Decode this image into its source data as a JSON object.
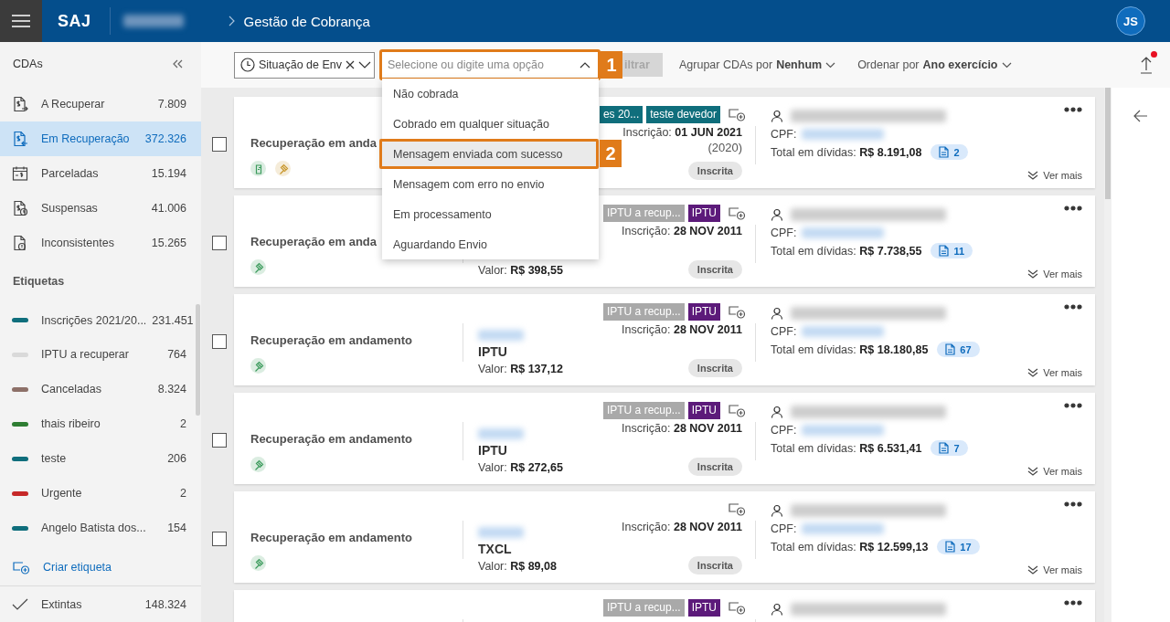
{
  "header": {
    "brand": "SAJ",
    "redacted_org": true,
    "breadcrumb": "Gestão de Cobrança",
    "avatar": "JS"
  },
  "sidebar": {
    "title": "CDAs",
    "items": [
      {
        "kind": "doc-out",
        "label": "A Recuperar",
        "count": "7.809",
        "selected": false
      },
      {
        "kind": "doc-in",
        "label": "Em Recuperação",
        "count": "372.326",
        "selected": true
      },
      {
        "kind": "calendar",
        "label": "Parceladas",
        "count": "15.194",
        "selected": false
      },
      {
        "kind": "doc-pause",
        "label": "Suspensas",
        "count": "41.006",
        "selected": false
      },
      {
        "kind": "doc-alert",
        "label": "Inconsistentes",
        "count": "15.265",
        "selected": false
      }
    ],
    "tags_title": "Etiquetas",
    "tags": [
      {
        "label": "Inscrições 2021/20...",
        "count": "231.451",
        "color": "#0f6e7c"
      },
      {
        "label": "IPTU a recuperar",
        "count": "764",
        "color": "#d9d9d9"
      },
      {
        "label": "Canceladas",
        "count": "8.324",
        "color": "#8d7068"
      },
      {
        "label": "thais ribeiro",
        "count": "2",
        "color": "#2e7d32"
      },
      {
        "label": "teste",
        "count": "206",
        "color": "#0f6e7c"
      },
      {
        "label": "Urgente",
        "count": "2",
        "color": "#c62828"
      },
      {
        "label": "Angelo Batista dos...",
        "count": "154",
        "color": "#0f6e7c"
      }
    ],
    "create_label": "Criar etiqueta",
    "footer": {
      "label": "Extintas",
      "count": "148.324"
    }
  },
  "toolbar": {
    "filter_chip": "Situação de Env",
    "combo": {
      "placeholder": "Selecione ou digite uma opção",
      "expanded": true,
      "callout": "1"
    },
    "filter_button": {
      "label": "iltrar",
      "disabled": true
    },
    "group_by": {
      "label": "Agrupar CDAs por",
      "value": "Nenhum"
    },
    "sort_by": {
      "label": "Ordenar por",
      "value": "Ano exercício"
    },
    "notification": true
  },
  "dropdown": {
    "options": [
      {
        "label": "Não cobrada",
        "selected": false
      },
      {
        "label": "Cobrado em qualquer situação",
        "selected": false
      },
      {
        "label": "Mensagem enviada com sucesso",
        "selected": true,
        "callout": "2"
      },
      {
        "label": "Mensagem com erro no envio",
        "selected": false
      },
      {
        "label": "Em processamento",
        "selected": false
      },
      {
        "label": "Aguardando Envio",
        "selected": false
      }
    ]
  },
  "cards": [
    {
      "checked": false,
      "title": "Recuperação em anda",
      "status_icons": [
        {
          "kind": "document",
          "color": "#3a9a5b"
        },
        {
          "kind": "gavel",
          "color": "#c8962a"
        }
      ],
      "tags": [
        {
          "label": "es 20...",
          "color": "#0f6e7c"
        },
        {
          "label": "teste devedor",
          "color": "#0f6e7c"
        }
      ],
      "inscricao_label": "Inscrição:",
      "inscricao_date": "01 JUN 2021",
      "year": "(2020)",
      "status": "Inscrita",
      "redacted_name": true,
      "cpf_label": "CPF:",
      "redacted_cpf": true,
      "total_label": "Total em dívidas:",
      "total": "R$ 8.191,08",
      "doc_count": "2",
      "more": "Ver mais"
    },
    {
      "checked": false,
      "title": "Recuperação em anda",
      "status_icons": [
        {
          "kind": "gavel",
          "color": "#3a9a5b"
        }
      ],
      "valor_label": "Valor:",
      "valor": "R$ 398,55",
      "tags": [
        {
          "label": "IPTU a recup...",
          "color": "#a9a9a9"
        },
        {
          "label": "IPTU",
          "color": "#5c1a7a"
        }
      ],
      "inscricao_label": "Inscrição:",
      "inscricao_date": "28 NOV 2011",
      "status": "Inscrita",
      "redacted_name": true,
      "cpf_label": "CPF:",
      "redacted_cpf": true,
      "total_label": "Total em dívidas:",
      "total": "R$ 7.738,55",
      "doc_count": "11",
      "more": "Ver mais"
    },
    {
      "checked": false,
      "title": "Recuperação em andamento",
      "status_icons": [
        {
          "kind": "gavel",
          "color": "#3a9a5b"
        }
      ],
      "redacted_id": true,
      "type": "IPTU",
      "valor_label": "Valor:",
      "valor": "R$ 137,12",
      "tags": [
        {
          "label": "IPTU a recup...",
          "color": "#a9a9a9"
        },
        {
          "label": "IPTU",
          "color": "#5c1a7a"
        }
      ],
      "inscricao_label": "Inscrição:",
      "inscricao_date": "28 NOV 2011",
      "status": "Inscrita",
      "redacted_name": true,
      "cpf_label": "CPF:",
      "redacted_cpf": true,
      "total_label": "Total em dívidas:",
      "total": "R$ 18.180,85",
      "doc_count": "67",
      "more": "Ver mais"
    },
    {
      "checked": false,
      "title": "Recuperação em andamento",
      "status_icons": [
        {
          "kind": "gavel",
          "color": "#3a9a5b"
        }
      ],
      "redacted_id": true,
      "type": "IPTU",
      "valor_label": "Valor:",
      "valor": "R$ 272,65",
      "tags": [
        {
          "label": "IPTU a recup...",
          "color": "#a9a9a9"
        },
        {
          "label": "IPTU",
          "color": "#5c1a7a"
        }
      ],
      "inscricao_label": "Inscrição:",
      "inscricao_date": "28 NOV 2011",
      "status": "Inscrita",
      "redacted_name": true,
      "cpf_label": "CPF:",
      "redacted_cpf": true,
      "total_label": "Total em dívidas:",
      "total": "R$ 6.531,41",
      "doc_count": "7",
      "more": "Ver mais"
    },
    {
      "checked": false,
      "title": "Recuperação em andamento",
      "status_icons": [
        {
          "kind": "gavel",
          "color": "#3a9a5b"
        }
      ],
      "redacted_id": true,
      "type": "TXCL",
      "valor_label": "Valor:",
      "valor": "R$ 89,08",
      "inscricao_label": "Inscrição:",
      "inscricao_date": "28 NOV 2011",
      "status": "Inscrita",
      "redacted_name": true,
      "cpf_label": "CPF:",
      "redacted_cpf": true,
      "total_label": "Total em dívidas:",
      "total": "R$ 12.599,13",
      "doc_count": "17",
      "more": "Ver mais"
    },
    {
      "tags": [
        {
          "label": "IPTU a recup...",
          "color": "#a9a9a9"
        },
        {
          "label": "IPTU",
          "color": "#5c1a7a"
        }
      ],
      "redacted_name": true
    }
  ]
}
